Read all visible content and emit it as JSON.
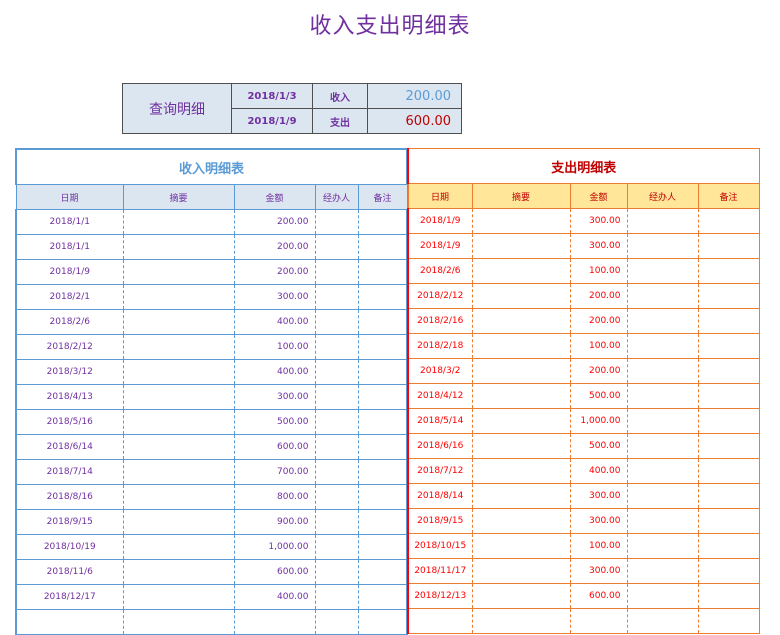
{
  "title": "收入支出明细表",
  "query": {
    "label": "查询明细",
    "start_date": "2018/1/3",
    "end_date": "2018/1/9",
    "income_label": "收入",
    "expense_label": "支出",
    "income_value": "200.00",
    "expense_value": "600.00"
  },
  "income": {
    "caption": "收入明细表",
    "headers": [
      "日期",
      "摘要",
      "金额",
      "经办人",
      "备注"
    ],
    "rows": [
      [
        "2018/1/1",
        "",
        "200.00",
        "",
        ""
      ],
      [
        "2018/1/1",
        "",
        "200.00",
        "",
        ""
      ],
      [
        "2018/1/9",
        "",
        "200.00",
        "",
        ""
      ],
      [
        "2018/2/1",
        "",
        "300.00",
        "",
        ""
      ],
      [
        "2018/2/6",
        "",
        "400.00",
        "",
        ""
      ],
      [
        "2018/2/12",
        "",
        "100.00",
        "",
        ""
      ],
      [
        "2018/3/12",
        "",
        "400.00",
        "",
        ""
      ],
      [
        "2018/4/13",
        "",
        "300.00",
        "",
        ""
      ],
      [
        "2018/5/16",
        "",
        "500.00",
        "",
        ""
      ],
      [
        "2018/6/14",
        "",
        "600.00",
        "",
        ""
      ],
      [
        "2018/7/14",
        "",
        "700.00",
        "",
        ""
      ],
      [
        "2018/8/16",
        "",
        "800.00",
        "",
        ""
      ],
      [
        "2018/9/15",
        "",
        "900.00",
        "",
        ""
      ],
      [
        "2018/10/19",
        "",
        "1,000.00",
        "",
        ""
      ],
      [
        "2018/11/6",
        "",
        "600.00",
        "",
        ""
      ],
      [
        "2018/12/17",
        "",
        "400.00",
        "",
        ""
      ],
      [
        "",
        "",
        "",
        "",
        ""
      ]
    ]
  },
  "expense": {
    "caption": "支出明细表",
    "headers": [
      "日期",
      "摘要",
      "金额",
      "经办人",
      "备注"
    ],
    "rows": [
      [
        "2018/1/9",
        "",
        "300.00",
        "",
        ""
      ],
      [
        "2018/1/9",
        "",
        "300.00",
        "",
        ""
      ],
      [
        "2018/2/6",
        "",
        "100.00",
        "",
        ""
      ],
      [
        "2018/2/12",
        "",
        "200.00",
        "",
        ""
      ],
      [
        "2018/2/16",
        "",
        "200.00",
        "",
        ""
      ],
      [
        "2018/2/18",
        "",
        "100.00",
        "",
        ""
      ],
      [
        "2018/3/2",
        "",
        "200.00",
        "",
        ""
      ],
      [
        "2018/4/12",
        "",
        "500.00",
        "",
        ""
      ],
      [
        "2018/5/14",
        "",
        "1,000.00",
        "",
        ""
      ],
      [
        "2018/6/16",
        "",
        "500.00",
        "",
        ""
      ],
      [
        "2018/7/12",
        "",
        "400.00",
        "",
        ""
      ],
      [
        "2018/8/14",
        "",
        "300.00",
        "",
        ""
      ],
      [
        "2018/9/15",
        "",
        "300.00",
        "",
        ""
      ],
      [
        "2018/10/15",
        "",
        "100.00",
        "",
        ""
      ],
      [
        "2018/11/17",
        "",
        "300.00",
        "",
        ""
      ],
      [
        "2018/12/13",
        "",
        "600.00",
        "",
        ""
      ],
      [
        "",
        "",
        "",
        "",
        ""
      ]
    ]
  }
}
